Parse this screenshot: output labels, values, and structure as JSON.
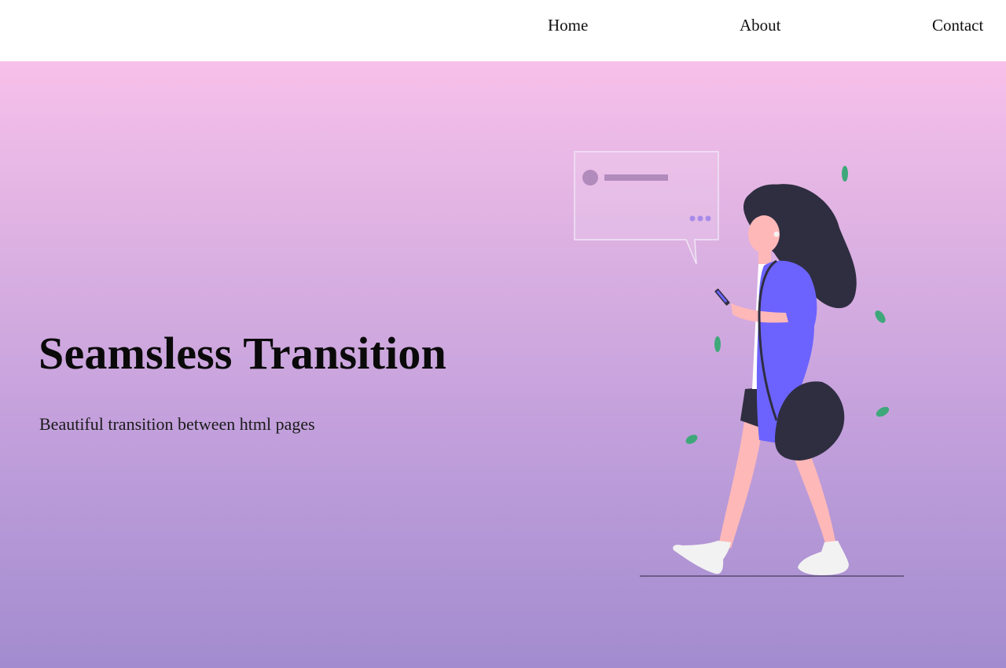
{
  "nav": {
    "home_label": "Home",
    "about_label": "About",
    "contact_label": "Contact"
  },
  "hero": {
    "title": "Seamsless Transition",
    "subtitle": "Beautiful transition between html pages"
  },
  "colors": {
    "gradient_top": "#f7c0ea",
    "gradient_bottom": "#a28ccf",
    "jacket": "#6c63ff",
    "hair": "#2f2e41",
    "skin": "#ffb8b8",
    "leaf": "#3fa87a"
  },
  "illustration": {
    "icon": "woman-walking-with-phone-illustration"
  }
}
